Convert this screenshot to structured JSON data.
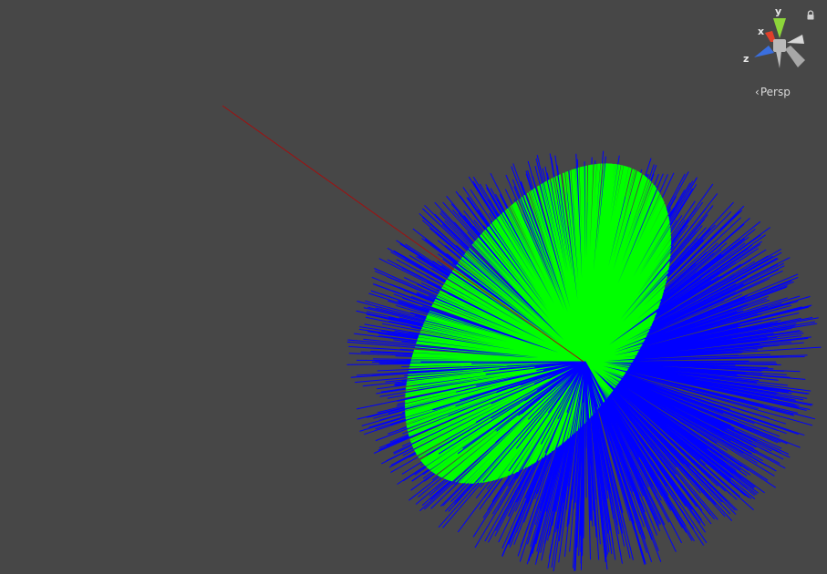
{
  "scene_view": {
    "background_color": "#474747",
    "objects": {
      "radial_lines_outer_color": "#0000ff",
      "radial_lines_inner_color": "#00ff00",
      "ray_color": "#a01010"
    }
  },
  "orientation_gizmo": {
    "axis_labels": {
      "x": "x",
      "y": "y",
      "z": "z"
    },
    "axis_colors": {
      "x": "#e0402a",
      "y": "#8dd63a",
      "z": "#3a6fe0",
      "neutral": "#c8c8c8"
    },
    "projection_label": "Persp",
    "icons": {
      "projection_toggle": "chevron-left-icon",
      "lock": "lock-icon"
    }
  }
}
